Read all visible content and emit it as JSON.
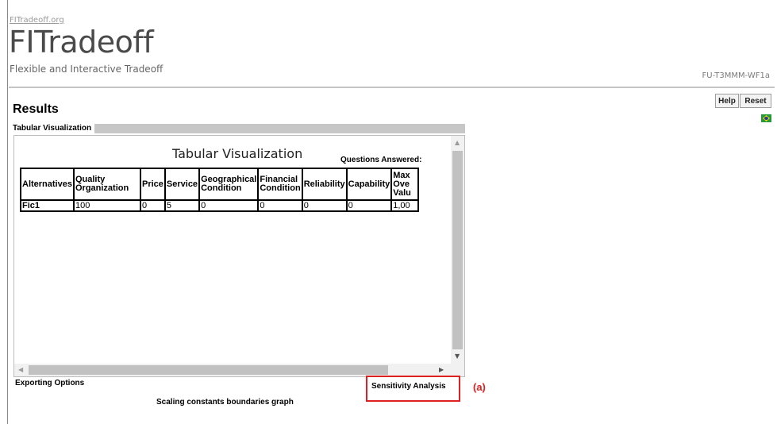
{
  "header": {
    "site_link": "FITradeoff.org",
    "logo_title": "FITradeoff",
    "logo_subtitle": "Flexible and Interactive Tradeoff",
    "version": "FU-T3MMM-WF1a"
  },
  "toolbar": {
    "help_label": "Help",
    "reset_label": "Reset",
    "language_flag_icon": "brazil-flag-icon"
  },
  "page": {
    "title": "Results"
  },
  "tabular_section": {
    "label": "Tabular Visualization",
    "inner_title": "Tabular Visualization",
    "questions_label": "Questions Answered:",
    "columns": [
      "Alternatives",
      "Quality\nOrganization",
      "Price",
      "Service",
      "Geographical\nCondition",
      "Financial\nCondition",
      "Reliability",
      "Capability",
      "Max\nOve\nValu"
    ],
    "rows": [
      [
        "Fic1",
        "100",
        "0",
        "5",
        "0",
        "0",
        "0",
        "0",
        "1,00"
      ]
    ]
  },
  "footer": {
    "exporting_label": "Exporting Options",
    "sensitivity_label": "Sensitivity Analysis",
    "annotation_marker": "(a)",
    "scaling_label": "Scaling constants boundaries graph"
  },
  "colors": {
    "highlight_red": "#e02020",
    "flag_green": "#239b3b",
    "flag_yellow": "#f2d20a",
    "flag_blue": "#1f3f9a"
  }
}
